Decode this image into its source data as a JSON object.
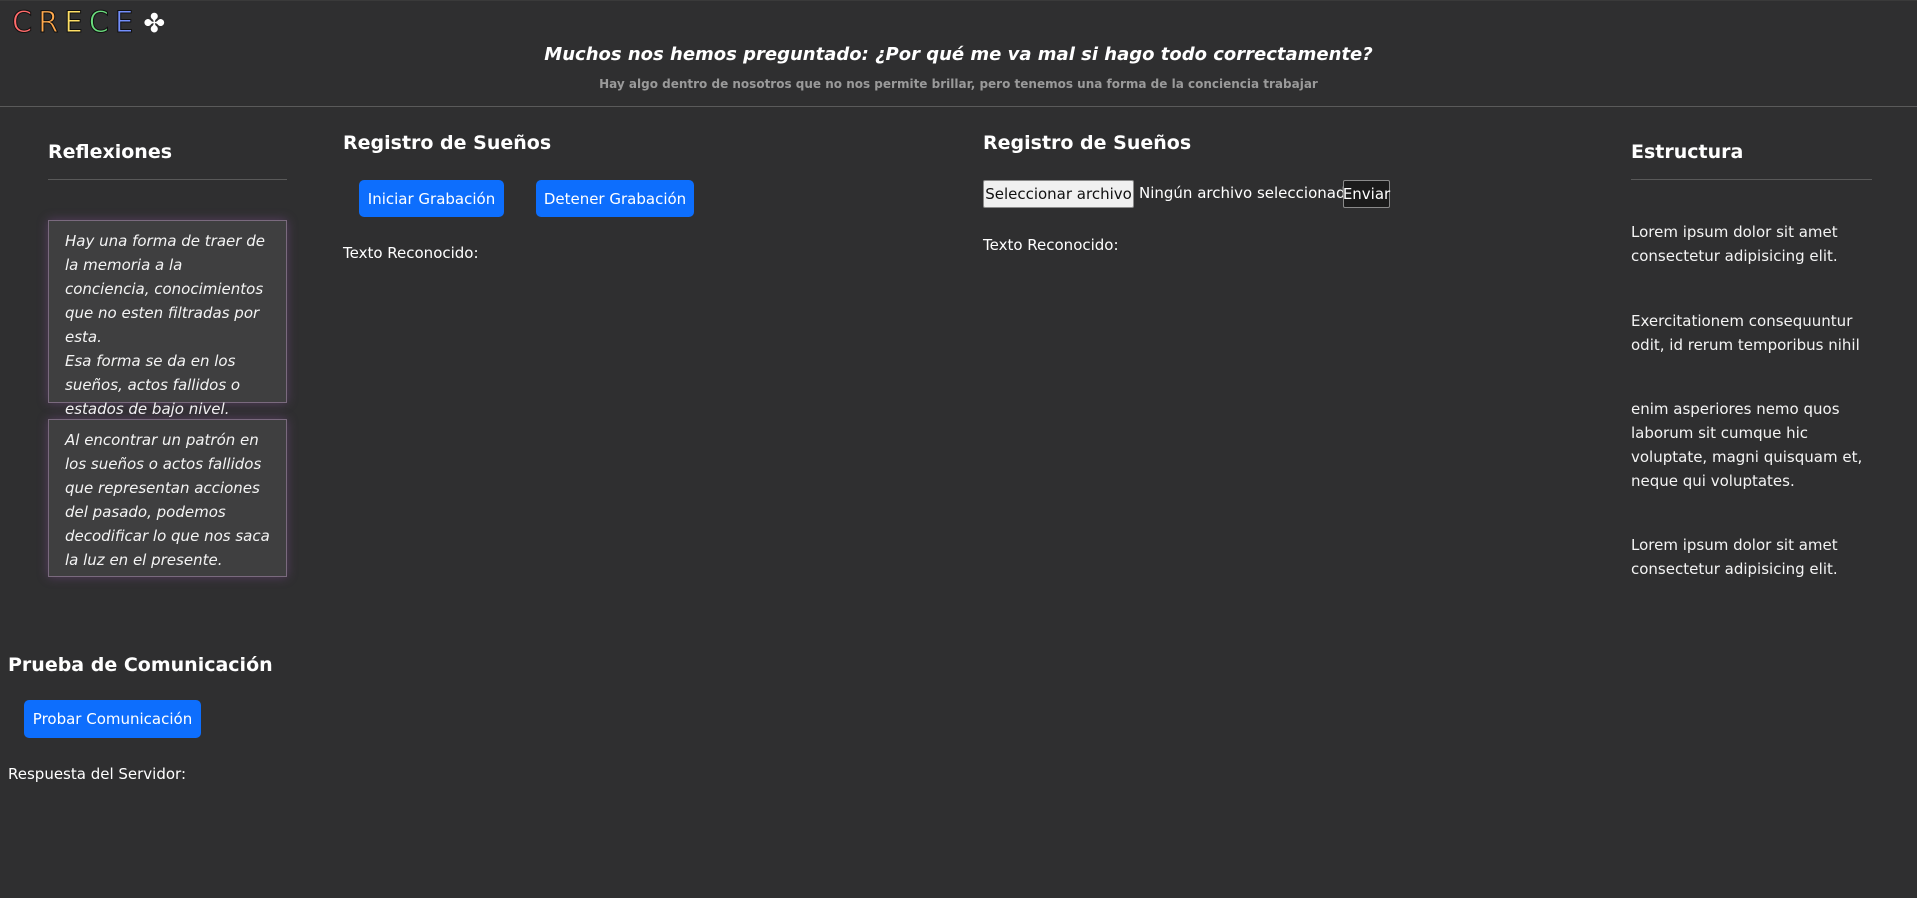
{
  "header": {
    "logo_letters": [
      "C",
      "R",
      "E",
      "C",
      "E"
    ],
    "logo_colors": [
      "#ff6b6b",
      "#ffa94d",
      "#ffe066",
      "#69db7c",
      "#748ffc"
    ],
    "clover": "✤",
    "title": "Muchos nos hemos preguntado: ¿Por qué me va mal si hago todo correctamente?",
    "subtitle": "Hay algo dentro de nosotros que no nos permite brillar, pero tenemos una forma de la conciencia trabajar"
  },
  "reflexiones": {
    "heading": "Reflexiones",
    "quotes": [
      {
        "line1": "Hay una forma de traer de la memoria a la conciencia, conocimientos que no esten filtradas por esta.",
        "line2": "Esa forma se da en los sueños, actos fallidos o estados de bajo nivel."
      },
      {
        "line1": "Al encontrar un patrón en los sueños o actos fallidos que representan acciones del pasado, podemos decodificar lo que nos saca la luz en el presente."
      }
    ]
  },
  "registro_voz": {
    "heading": "Registro de Sueños",
    "start_label": "Iniciar Grabación",
    "stop_label": "Detener Grabación",
    "recognized_label": "Texto Reconocido:"
  },
  "registro_archivo": {
    "heading": "Registro de Sueños",
    "file_button": "Seleccionar archivo",
    "file_status": "Ningún archivo seleccionado",
    "send_label": "Enviar",
    "recognized_label": "Texto Reconocido:"
  },
  "estructura": {
    "heading": "Estructura",
    "items": [
      "Lorem ipsum dolor sit amet consectetur adipisicing elit.",
      "Exercitationem consequuntur odit, id rerum temporibus nihil",
      "enim asperiores nemo quos laborum sit cumque hic voluptate, magni quisquam et, neque qui voluptates.",
      "Lorem ipsum dolor sit amet consectetur adipisicing elit."
    ]
  },
  "comunicacion": {
    "heading": "Prueba de Comunicación",
    "test_label": "Probar Comunicación",
    "response_label": "Respuesta del Servidor:"
  }
}
